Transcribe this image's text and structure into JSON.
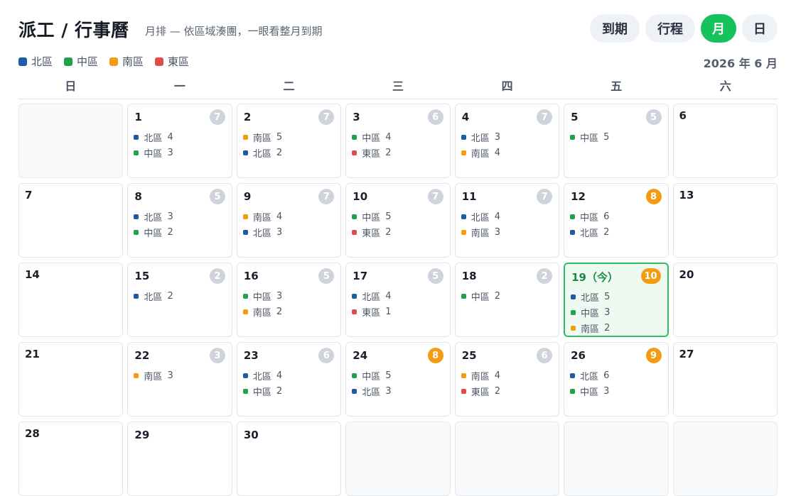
{
  "header": {
    "title": "派工 / 行事曆",
    "subtitle": "月排 — 依區域湊團，一眼看整月到期"
  },
  "views": [
    {
      "label": "到期",
      "active": false,
      "size": "w70"
    },
    {
      "label": "行程",
      "active": false,
      "size": "w70"
    },
    {
      "label": "月",
      "active": true,
      "size": "w50"
    },
    {
      "label": "日",
      "active": false,
      "size": "w50"
    }
  ],
  "regions": {
    "north": {
      "label": "北區",
      "color": "#1f5aa6"
    },
    "central": {
      "label": "中區",
      "color": "#1ea34a"
    },
    "south": {
      "label": "南區",
      "color": "#f39c12"
    },
    "east": {
      "label": "東區",
      "color": "#e04a4a"
    }
  },
  "legend_order": [
    "north",
    "central",
    "south",
    "east"
  ],
  "month_label": "2026 年 6 月",
  "weekdays": [
    "日",
    "一",
    "二",
    "三",
    "四",
    "五",
    "六"
  ],
  "today_suffix": "（今）",
  "days": [
    {
      "empty": true
    },
    {
      "day": "1",
      "total": "7",
      "entries": [
        [
          "north",
          "4"
        ],
        [
          "central",
          "3"
        ]
      ]
    },
    {
      "day": "2",
      "total": "7",
      "entries": [
        [
          "south",
          "5"
        ],
        [
          "north",
          "2"
        ]
      ]
    },
    {
      "day": "3",
      "total": "6",
      "entries": [
        [
          "central",
          "4"
        ],
        [
          "east",
          "2"
        ]
      ]
    },
    {
      "day": "4",
      "total": "7",
      "entries": [
        [
          "north",
          "3"
        ],
        [
          "south",
          "4"
        ]
      ]
    },
    {
      "day": "5",
      "total": "5",
      "entries": [
        [
          "central",
          "5"
        ]
      ]
    },
    {
      "day": "6",
      "weekend": true
    },
    {
      "day": "7",
      "weekend": true
    },
    {
      "day": "8",
      "total": "5",
      "entries": [
        [
          "north",
          "3"
        ],
        [
          "central",
          "2"
        ]
      ]
    },
    {
      "day": "9",
      "total": "7",
      "entries": [
        [
          "south",
          "4"
        ],
        [
          "north",
          "3"
        ]
      ]
    },
    {
      "day": "10",
      "total": "7",
      "entries": [
        [
          "central",
          "5"
        ],
        [
          "east",
          "2"
        ]
      ]
    },
    {
      "day": "11",
      "total": "7",
      "entries": [
        [
          "north",
          "4"
        ],
        [
          "south",
          "3"
        ]
      ]
    },
    {
      "day": "12",
      "total": "8",
      "hot": true,
      "entries": [
        [
          "central",
          "6"
        ],
        [
          "north",
          "2"
        ]
      ]
    },
    {
      "day": "13",
      "weekend": true
    },
    {
      "day": "14",
      "weekend": true
    },
    {
      "day": "15",
      "total": "2",
      "entries": [
        [
          "north",
          "2"
        ]
      ]
    },
    {
      "day": "16",
      "total": "5",
      "entries": [
        [
          "central",
          "3"
        ],
        [
          "south",
          "2"
        ]
      ]
    },
    {
      "day": "17",
      "total": "5",
      "entries": [
        [
          "north",
          "4"
        ],
        [
          "east",
          "1"
        ]
      ]
    },
    {
      "day": "18",
      "total": "2",
      "entries": [
        [
          "central",
          "2"
        ]
      ]
    },
    {
      "day": "19",
      "total": "10",
      "hot": true,
      "today": true,
      "entries": [
        [
          "north",
          "5"
        ],
        [
          "central",
          "3"
        ],
        [
          "south",
          "2"
        ]
      ]
    },
    {
      "day": "20",
      "weekend": true
    },
    {
      "day": "21",
      "weekend": true
    },
    {
      "day": "22",
      "total": "3",
      "entries": [
        [
          "south",
          "3"
        ]
      ]
    },
    {
      "day": "23",
      "total": "6",
      "entries": [
        [
          "north",
          "4"
        ],
        [
          "central",
          "2"
        ]
      ]
    },
    {
      "day": "24",
      "total": "8",
      "hot": true,
      "entries": [
        [
          "central",
          "5"
        ],
        [
          "north",
          "3"
        ]
      ]
    },
    {
      "day": "25",
      "total": "6",
      "entries": [
        [
          "south",
          "4"
        ],
        [
          "east",
          "2"
        ]
      ]
    },
    {
      "day": "26",
      "total": "9",
      "hot": true,
      "entries": [
        [
          "north",
          "6"
        ],
        [
          "central",
          "3"
        ]
      ]
    },
    {
      "day": "27",
      "weekend": true
    },
    {
      "day": "28",
      "weekend": true
    },
    {
      "day": "29"
    },
    {
      "day": "30"
    },
    {
      "empty": true
    },
    {
      "empty": true
    },
    {
      "empty": true
    },
    {
      "empty": true
    }
  ]
}
